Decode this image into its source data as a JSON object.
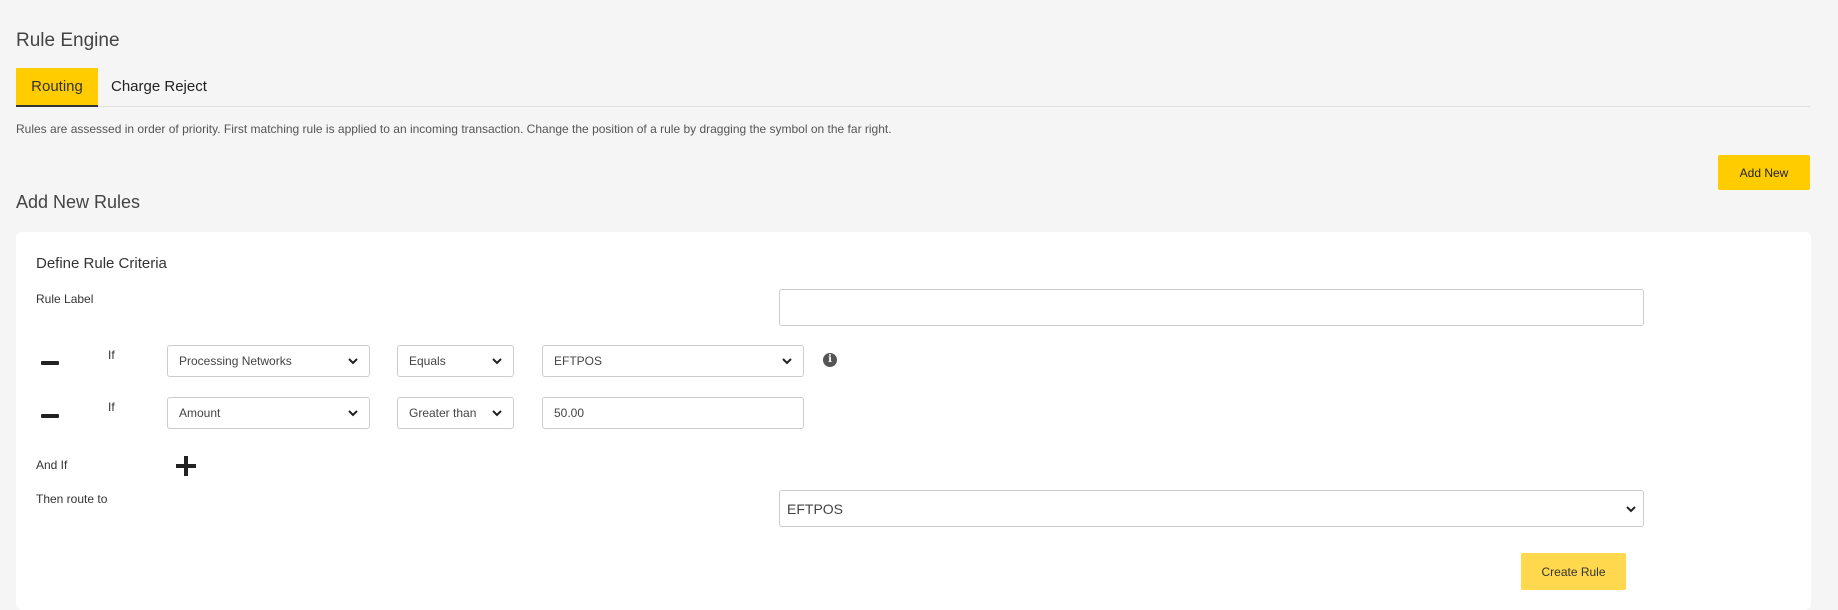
{
  "page": {
    "title": "Rule Engine",
    "description": "Rules are assessed in order of priority. First matching rule is applied to an incoming transaction. Change the position of a rule by dragging the symbol on the far right."
  },
  "tabs": [
    {
      "label": "Routing",
      "active": true
    },
    {
      "label": "Charge Reject",
      "active": false
    }
  ],
  "toolbar": {
    "add_new_label": "Add New"
  },
  "section": {
    "title": "Add New Rules"
  },
  "card": {
    "title": "Define Rule Criteria",
    "rule_label": {
      "label": "Rule Label",
      "value": ""
    },
    "conditions": [
      {
        "prefix": "If",
        "field": "Processing Networks",
        "operator": "Equals",
        "value": "EFTPOS",
        "value_type": "select",
        "has_info": true
      },
      {
        "prefix": "If",
        "field": "Amount",
        "operator": "Greater than",
        "value": "50.00",
        "value_type": "input",
        "has_info": false
      }
    ],
    "and_if_label": "And If",
    "route_label": "Then route to",
    "route_value": "EFTPOS",
    "create_label": "Create Rule"
  },
  "icons": {
    "minus": "minus-icon",
    "plus": "plus-icon",
    "info": "info-icon",
    "chevron": "chevron-down-icon"
  },
  "colors": {
    "accent": "#ffcc00",
    "create_button": "#ffd84d",
    "background": "#f5f5f5",
    "card": "#ffffff"
  }
}
